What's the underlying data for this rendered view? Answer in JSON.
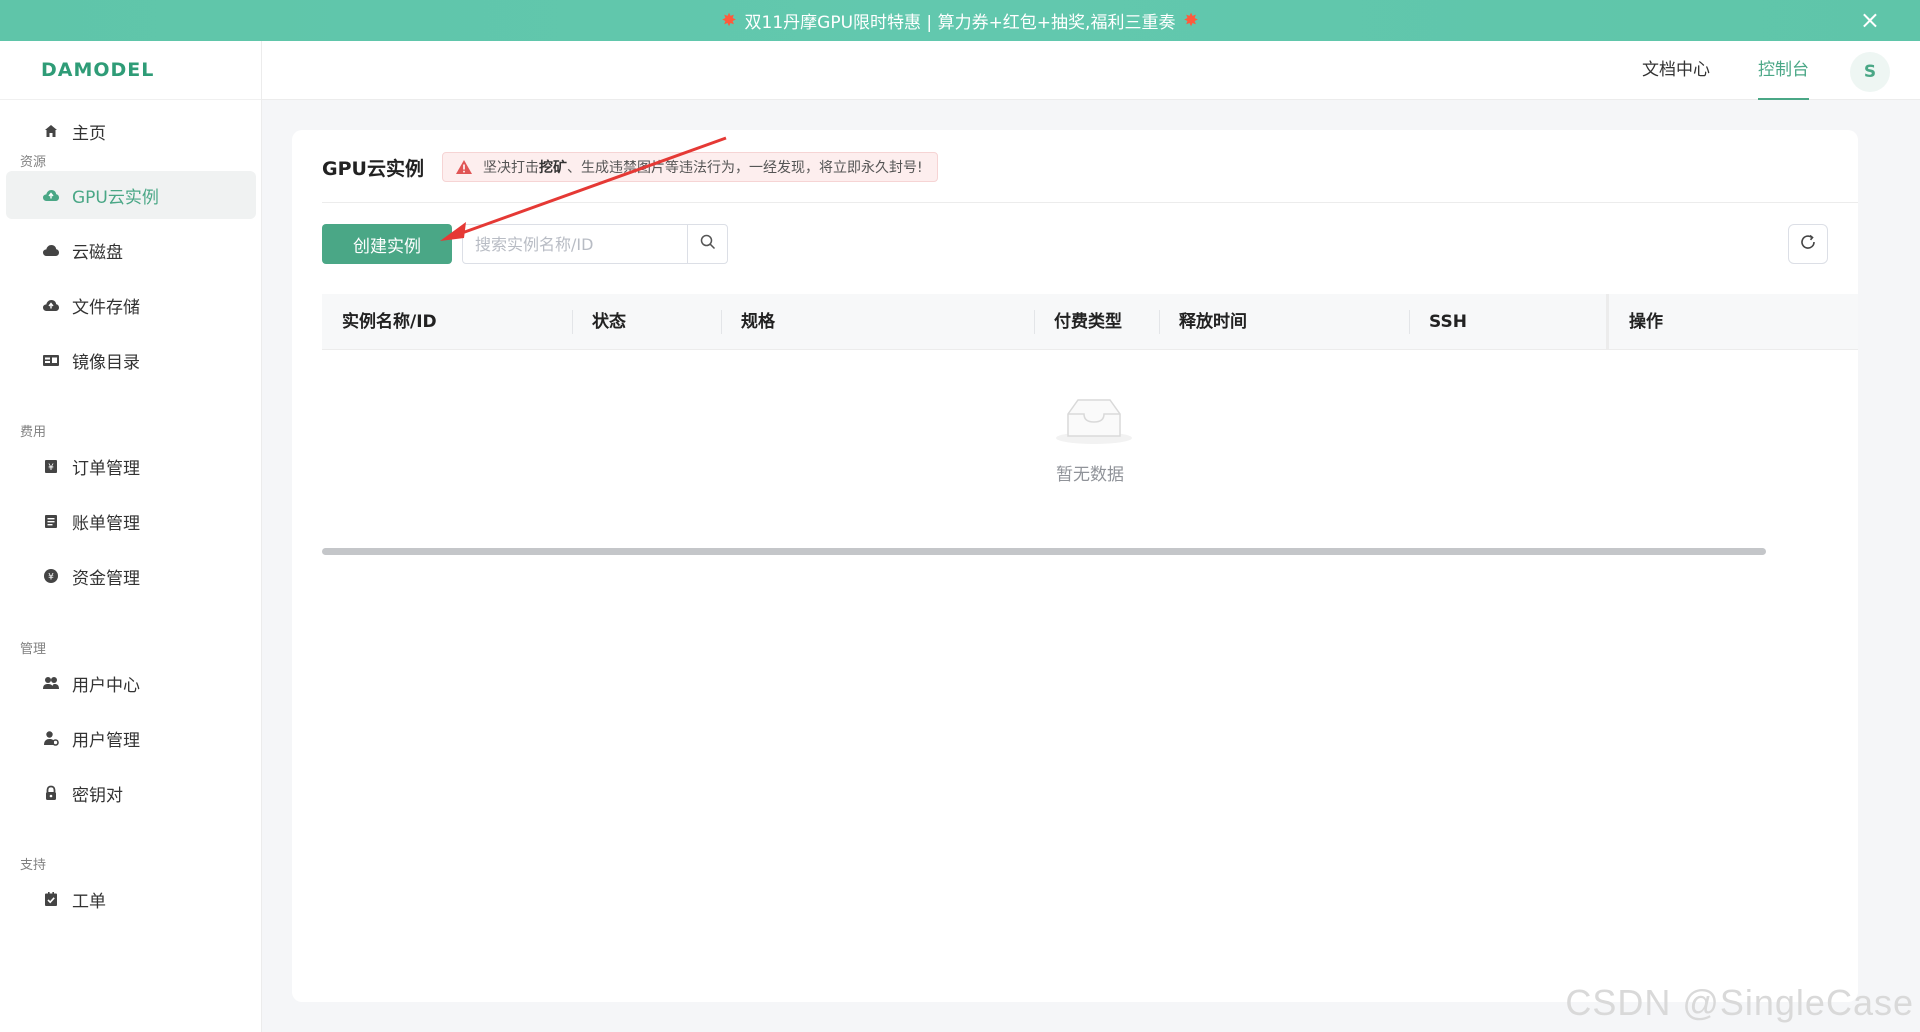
{
  "promo": {
    "text": "双11丹摩GPU限时特惠 | 算力券+红包+抽奖,福利三重奏",
    "close": "×"
  },
  "brand": {
    "logo": "DAMODEL"
  },
  "header": {
    "docs": "文档中心",
    "console": "控制台",
    "avatar": "S"
  },
  "sidebar": {
    "home": "主页",
    "groups": {
      "resources": "资源",
      "billing": "费用",
      "manage": "管理",
      "support": "支持"
    },
    "items": {
      "gpu": "GPU云实例",
      "disk": "云磁盘",
      "file": "文件存储",
      "image": "镜像目录",
      "order": "订单管理",
      "bill": "账单管理",
      "fund": "资金管理",
      "user_center": "用户中心",
      "user_manage": "用户管理",
      "keypair": "密钥对",
      "ticket": "工单"
    }
  },
  "main": {
    "title": "GPU云实例",
    "alert_prefix": "坚决打击 ",
    "alert_bold": "挖矿",
    "alert_suffix": "、生成违禁图片等违法行为，一经发现，将立即永久封号!",
    "create_button": "创建实例",
    "search_placeholder": "搜索实例名称/ID",
    "columns": {
      "name": "实例名称/ID",
      "status": "状态",
      "spec": "规格",
      "pay_type": "付费类型",
      "release": "释放时间",
      "ssh": "SSH",
      "ops": "操作"
    },
    "empty_text": "暂无数据"
  },
  "watermark": "CSDN @SingleCase",
  "colors": {
    "accent": "#4aa786",
    "banner": "#5fc5a9",
    "alert_bg": "#fdeeee",
    "alert_icon": "#e05555",
    "annotation_arrow": "#e53935"
  }
}
